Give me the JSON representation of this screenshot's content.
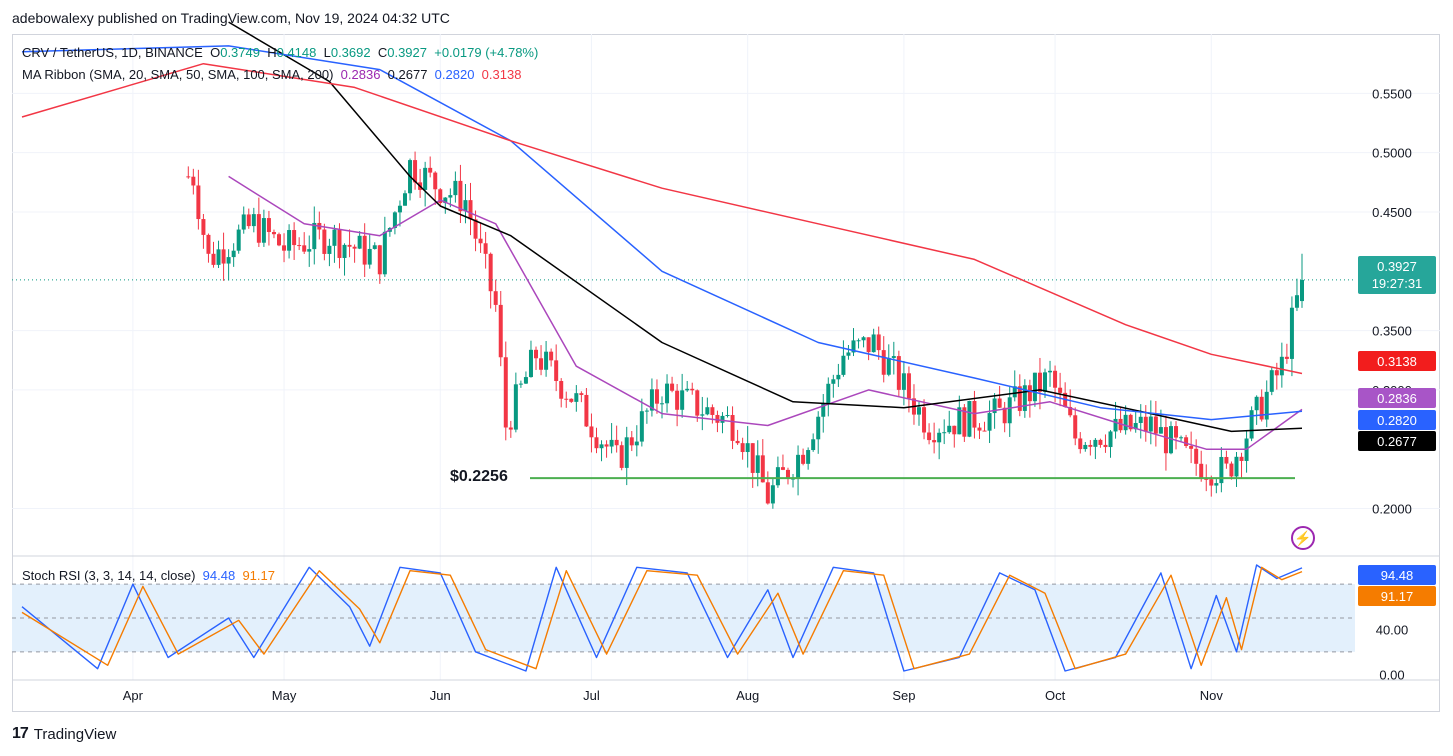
{
  "header": "adebowalexy published on TradingView.com, Nov 19, 2024 04:32 UTC",
  "legend": {
    "symbol": "CRV / TetherUS, 1D, BINANCE",
    "o_label": "O",
    "o_value": "0.3749",
    "h_label": "H",
    "h_value": "0.4148",
    "l_label": "L",
    "l_value": "0.3692",
    "c_label": "C",
    "c_value": "0.3927",
    "change": "+0.0179 (+4.78%)",
    "ma_label": "MA Ribbon (SMA, 20, SMA, 50, SMA, 100, SMA, 200)",
    "ma20": "0.2836",
    "ma50": "0.2677",
    "ma100": "0.2820",
    "ma200": "0.3138",
    "rsi_label": "Stoch RSI (3, 3, 14, 14, close)",
    "rsi_k": "94.48",
    "rsi_d": "91.17"
  },
  "price_tags": {
    "last": "0.3927",
    "countdown": "19:27:31",
    "ma200": "0.3138",
    "ma20": "0.2836",
    "ma100": "0.2820",
    "ma50": "0.2677",
    "rsi_k": "94.48",
    "rsi_d": "91.17"
  },
  "annotation": "$0.2256",
  "footer": {
    "logo": "17",
    "brand": "TradingView"
  },
  "colors": {
    "up": "#089981",
    "down": "#f23645",
    "ma20": "#ab47bc",
    "ma50": "#000000",
    "ma100": "#2962ff",
    "ma200": "#f23645",
    "support": "#4caf50",
    "rsi_k": "#2962ff",
    "rsi_d": "#f57c00",
    "rsi_band": "#e3f0fc"
  },
  "chart_data": [
    {
      "type": "candlestick",
      "title": "CRV / TetherUS, 1D, BINANCE",
      "x_ticks": [
        "Apr",
        "May",
        "Jun",
        "Jul",
        "Aug",
        "Sep",
        "Oct",
        "Nov"
      ],
      "x_tick_dates": [
        "2024-04-01",
        "2024-05-01",
        "2024-06-01",
        "2024-07-01",
        "2024-08-01",
        "2024-09-01",
        "2024-10-01",
        "2024-11-01"
      ],
      "x_range": [
        "2024-03-10",
        "2024-11-19"
      ],
      "y_ticks": [
        "0.2000",
        "0.3000",
        "0.3500",
        "0.4500",
        "0.5000",
        "0.5500"
      ],
      "ylim": [
        0.16,
        0.6
      ],
      "last": {
        "date": "2024-11-19",
        "open": 0.3749,
        "high": 0.4148,
        "low": 0.3692,
        "close": 0.3927
      },
      "support_level": 0.2256,
      "price_path": [
        {
          "date": "2024-04-13",
          "price": 0.48
        },
        {
          "date": "2024-04-16",
          "price": 0.41
        },
        {
          "date": "2024-04-25",
          "price": 0.44
        },
        {
          "date": "2024-05-01",
          "price": 0.42
        },
        {
          "date": "2024-05-10",
          "price": 0.43
        },
        {
          "date": "2024-05-20",
          "price": 0.41
        },
        {
          "date": "2024-05-26",
          "price": 0.49
        },
        {
          "date": "2024-06-01",
          "price": 0.47
        },
        {
          "date": "2024-06-06",
          "price": 0.46
        },
        {
          "date": "2024-06-12",
          "price": 0.37
        },
        {
          "date": "2024-06-14",
          "price": 0.27
        },
        {
          "date": "2024-06-20",
          "price": 0.33
        },
        {
          "date": "2024-06-28",
          "price": 0.29
        },
        {
          "date": "2024-07-06",
          "price": 0.24
        },
        {
          "date": "2024-07-15",
          "price": 0.3
        },
        {
          "date": "2024-07-30",
          "price": 0.27
        },
        {
          "date": "2024-08-05",
          "price": 0.21
        },
        {
          "date": "2024-08-12",
          "price": 0.25
        },
        {
          "date": "2024-08-20",
          "price": 0.33
        },
        {
          "date": "2024-08-26",
          "price": 0.34
        },
        {
          "date": "2024-09-06",
          "price": 0.27
        },
        {
          "date": "2024-09-20",
          "price": 0.28
        },
        {
          "date": "2024-09-30",
          "price": 0.31
        },
        {
          "date": "2024-10-05",
          "price": 0.26
        },
        {
          "date": "2024-10-20",
          "price": 0.27
        },
        {
          "date": "2024-10-28",
          "price": 0.24
        },
        {
          "date": "2024-11-04",
          "price": 0.23
        },
        {
          "date": "2024-11-10",
          "price": 0.28
        },
        {
          "date": "2024-11-15",
          "price": 0.32
        },
        {
          "date": "2024-11-19",
          "price": 0.3927
        }
      ],
      "series": [
        {
          "name": "SMA 20",
          "points": [
            {
              "date": "2024-04-20",
              "value": 0.48
            },
            {
              "date": "2024-05-05",
              "value": 0.44
            },
            {
              "date": "2024-05-20",
              "value": 0.43
            },
            {
              "date": "2024-06-01",
              "value": 0.46
            },
            {
              "date": "2024-06-12",
              "value": 0.44
            },
            {
              "date": "2024-06-28",
              "value": 0.32
            },
            {
              "date": "2024-07-15",
              "value": 0.28
            },
            {
              "date": "2024-08-05",
              "value": 0.27
            },
            {
              "date": "2024-08-25",
              "value": 0.3
            },
            {
              "date": "2024-09-15",
              "value": 0.28
            },
            {
              "date": "2024-09-30",
              "value": 0.29
            },
            {
              "date": "2024-10-15",
              "value": 0.27
            },
            {
              "date": "2024-10-31",
              "value": 0.25
            },
            {
              "date": "2024-11-08",
              "value": 0.25
            },
            {
              "date": "2024-11-19",
              "value": 0.2836
            }
          ]
        },
        {
          "name": "SMA 50",
          "points": [
            {
              "date": "2024-04-20",
              "value": 0.61
            },
            {
              "date": "2024-05-10",
              "value": 0.56
            },
            {
              "date": "2024-05-26",
              "value": 0.48
            },
            {
              "date": "2024-06-01",
              "value": 0.455
            },
            {
              "date": "2024-06-15",
              "value": 0.43
            },
            {
              "date": "2024-07-15",
              "value": 0.34
            },
            {
              "date": "2024-08-10",
              "value": 0.29
            },
            {
              "date": "2024-09-01",
              "value": 0.285
            },
            {
              "date": "2024-09-28",
              "value": 0.3
            },
            {
              "date": "2024-10-20",
              "value": 0.28
            },
            {
              "date": "2024-11-05",
              "value": 0.265
            },
            {
              "date": "2024-11-19",
              "value": 0.2677
            }
          ]
        },
        {
          "name": "SMA 100",
          "points": [
            {
              "date": "2024-03-10",
              "value": 0.585
            },
            {
              "date": "2024-04-20",
              "value": 0.59
            },
            {
              "date": "2024-05-20",
              "value": 0.57
            },
            {
              "date": "2024-06-15",
              "value": 0.51
            },
            {
              "date": "2024-07-15",
              "value": 0.4
            },
            {
              "date": "2024-08-15",
              "value": 0.34
            },
            {
              "date": "2024-09-15",
              "value": 0.31
            },
            {
              "date": "2024-10-10",
              "value": 0.285
            },
            {
              "date": "2024-11-01",
              "value": 0.275
            },
            {
              "date": "2024-11-19",
              "value": 0.282
            }
          ]
        },
        {
          "name": "SMA 200",
          "points": [
            {
              "date": "2024-03-10",
              "value": 0.53
            },
            {
              "date": "2024-04-15",
              "value": 0.575
            },
            {
              "date": "2024-05-15",
              "value": 0.555
            },
            {
              "date": "2024-06-15",
              "value": 0.51
            },
            {
              "date": "2024-07-15",
              "value": 0.47
            },
            {
              "date": "2024-08-15",
              "value": 0.44
            },
            {
              "date": "2024-09-15",
              "value": 0.41
            },
            {
              "date": "2024-10-15",
              "value": 0.355
            },
            {
              "date": "2024-11-01",
              "value": 0.33
            },
            {
              "date": "2024-11-19",
              "value": 0.3138
            }
          ]
        }
      ]
    },
    {
      "type": "line",
      "title": "Stoch RSI (3, 3, 14, 14, close)",
      "y_ticks": [
        "0.00",
        "40.00"
      ],
      "ylim": [
        -5,
        105
      ],
      "band": [
        20,
        80
      ],
      "series": [
        {
          "name": "K",
          "values": [
            {
              "date": "2024-03-10",
              "value": 60
            },
            {
              "date": "2024-03-25",
              "value": 5
            },
            {
              "date": "2024-04-01",
              "value": 80
            },
            {
              "date": "2024-04-08",
              "value": 15
            },
            {
              "date": "2024-04-20",
              "value": 50
            },
            {
              "date": "2024-04-25",
              "value": 15
            },
            {
              "date": "2024-05-06",
              "value": 95
            },
            {
              "date": "2024-05-14",
              "value": 60
            },
            {
              "date": "2024-05-18",
              "value": 25
            },
            {
              "date": "2024-05-24",
              "value": 95
            },
            {
              "date": "2024-06-01",
              "value": 90
            },
            {
              "date": "2024-06-08",
              "value": 20
            },
            {
              "date": "2024-06-18",
              "value": 3
            },
            {
              "date": "2024-06-24",
              "value": 95
            },
            {
              "date": "2024-07-02",
              "value": 15
            },
            {
              "date": "2024-07-10",
              "value": 95
            },
            {
              "date": "2024-07-20",
              "value": 90
            },
            {
              "date": "2024-07-28",
              "value": 15
            },
            {
              "date": "2024-08-05",
              "value": 75
            },
            {
              "date": "2024-08-10",
              "value": 15
            },
            {
              "date": "2024-08-18",
              "value": 95
            },
            {
              "date": "2024-08-26",
              "value": 90
            },
            {
              "date": "2024-09-01",
              "value": 3
            },
            {
              "date": "2024-09-12",
              "value": 15
            },
            {
              "date": "2024-09-20",
              "value": 90
            },
            {
              "date": "2024-09-27",
              "value": 75
            },
            {
              "date": "2024-10-03",
              "value": 3
            },
            {
              "date": "2024-10-13",
              "value": 15
            },
            {
              "date": "2024-10-22",
              "value": 90
            },
            {
              "date": "2024-10-28",
              "value": 5
            },
            {
              "date": "2024-11-02",
              "value": 70
            },
            {
              "date": "2024-11-06",
              "value": 20
            },
            {
              "date": "2024-11-10",
              "value": 97
            },
            {
              "date": "2024-11-14",
              "value": 85
            },
            {
              "date": "2024-11-19",
              "value": 94.48
            }
          ]
        },
        {
          "name": "D",
          "values": [
            {
              "date": "2024-03-10",
              "value": 55
            },
            {
              "date": "2024-03-27",
              "value": 8
            },
            {
              "date": "2024-04-03",
              "value": 78
            },
            {
              "date": "2024-04-10",
              "value": 18
            },
            {
              "date": "2024-04-22",
              "value": 48
            },
            {
              "date": "2024-04-27",
              "value": 18
            },
            {
              "date": "2024-05-08",
              "value": 92
            },
            {
              "date": "2024-05-16",
              "value": 58
            },
            {
              "date": "2024-05-20",
              "value": 28
            },
            {
              "date": "2024-05-26",
              "value": 92
            },
            {
              "date": "2024-06-03",
              "value": 88
            },
            {
              "date": "2024-06-10",
              "value": 22
            },
            {
              "date": "2024-06-20",
              "value": 5
            },
            {
              "date": "2024-06-26",
              "value": 92
            },
            {
              "date": "2024-07-04",
              "value": 18
            },
            {
              "date": "2024-07-12",
              "value": 92
            },
            {
              "date": "2024-07-22",
              "value": 88
            },
            {
              "date": "2024-07-30",
              "value": 18
            },
            {
              "date": "2024-08-07",
              "value": 72
            },
            {
              "date": "2024-08-12",
              "value": 18
            },
            {
              "date": "2024-08-20",
              "value": 92
            },
            {
              "date": "2024-08-28",
              "value": 88
            },
            {
              "date": "2024-09-03",
              "value": 5
            },
            {
              "date": "2024-09-14",
              "value": 18
            },
            {
              "date": "2024-09-22",
              "value": 88
            },
            {
              "date": "2024-09-29",
              "value": 72
            },
            {
              "date": "2024-10-05",
              "value": 5
            },
            {
              "date": "2024-10-15",
              "value": 18
            },
            {
              "date": "2024-10-24",
              "value": 88
            },
            {
              "date": "2024-10-30",
              "value": 8
            },
            {
              "date": "2024-11-04",
              "value": 68
            },
            {
              "date": "2024-11-07",
              "value": 22
            },
            {
              "date": "2024-11-11",
              "value": 95
            },
            {
              "date": "2024-11-15",
              "value": 84
            },
            {
              "date": "2024-11-19",
              "value": 91.17
            }
          ]
        }
      ]
    }
  ]
}
